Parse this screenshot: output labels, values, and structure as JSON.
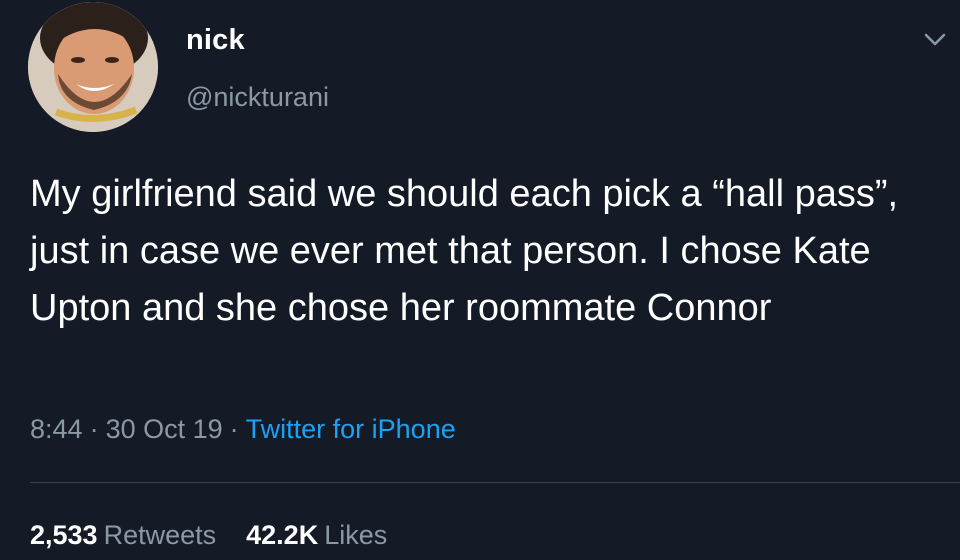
{
  "author": {
    "name": "nick",
    "handle": "@nickturani",
    "avatar_icon": "profile-photo"
  },
  "menu_icon": "chevron-down-icon",
  "tweet": {
    "text": "My girlfriend said we should each pick a “hall pass”, just in case we ever met that person. I chose Kate Upton and she chose her roommate Connor",
    "time": "8:44",
    "date": "30 Oct 19",
    "source": "Twitter for iPhone"
  },
  "stats": {
    "retweets_count": "2,533",
    "retweets_label": "Retweets",
    "likes_count": "42.2K",
    "likes_label": "Likes"
  },
  "colors": {
    "background": "#141b26",
    "text": "#ffffff",
    "secondary": "#8b98a5",
    "link": "#1da1f2",
    "divider": "#38444d"
  }
}
